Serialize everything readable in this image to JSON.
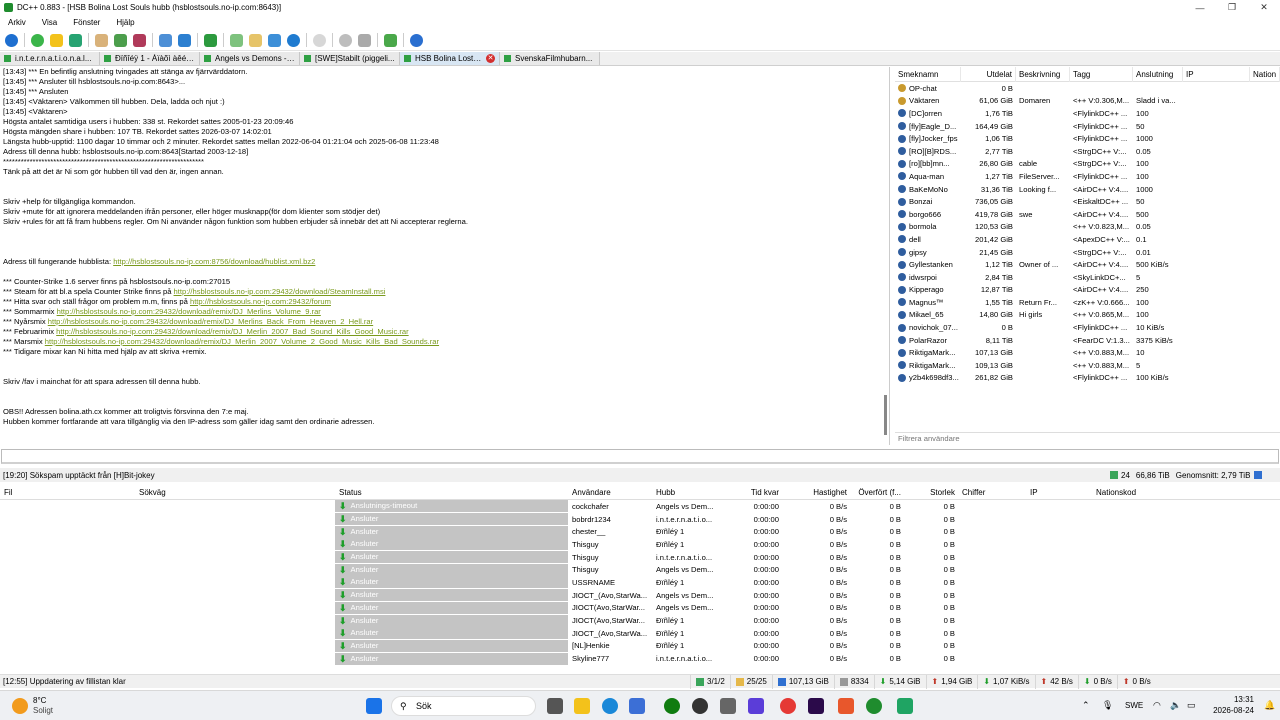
{
  "window": {
    "title": "DC++ 0.883 - [HSB Bolina Lost Souls hubb (hsblostsouls.no-ip.com:8643)]",
    "minimize": "—",
    "maximize": "❐",
    "close": "✕"
  },
  "menu": [
    "Arkiv",
    "Visa",
    "Fönster",
    "Hjälp"
  ],
  "tabs": [
    {
      "label": "i.n.t.e.r.n.a.t.i.o.n.a.l..."
    },
    {
      "label": "Ðïñîéÿ 1 - Àïàõì àêéå..."
    },
    {
      "label": "Angels vs Demons - ..."
    },
    {
      "label": "[SWE]Stabilt (piggeli..."
    },
    {
      "label": "HSB Bolina Lost ..."
    },
    {
      "label": "SvenskaFilmhubarn..."
    }
  ],
  "chat": [
    "[13:43] *** En befintlig anslutning tvingades att stänga av fjärrvärddatorn.",
    "[13:45] *** Ansluter till hsblostsouls.no-ip.com:8643>...",
    "[13:45] *** Ansluten",
    "[13:45] <Väktaren> Välkommen till hubben. Dela, ladda och njut :)",
    "[13:45] <Väktaren>",
    "Högsta antalet samtidiga users i hubben: 338 st. Rekordet sattes 2005-01-23 20:09:46",
    "Högsta mängden share i hubben: 107 TB. Rekordet sattes 2026-03-07 14:02:01",
    "Längsta hubb-upptid: 1100 dagar 10 timmar och 2 minuter. Rekordet sattes mellan 2022-06-04 01:21:04 och 2025-06-08 11:23:48",
    "Adress till denna hubb: hsblostsouls.no-ip.com:8643[Startad 2003-12-18]",
    "********************************************************************",
    "Tänk på att det är Ni som gör hubben till vad den är, ingen annan.",
    "",
    "",
    "Skriv +help för tillgängliga kommandon.",
    "Skriv +mute för att ignorera meddelanden ifrån personer, eller höger musknapp(för dom klienter som stödjer det)",
    "Skriv +rules för att få fram hubbens regler. Om Ni använder någon funktion som hubben erbjuder så innebär det att Ni accepterar reglerna.",
    "",
    "",
    "",
    "Adress till fungerande hubblista: |http://hsblostsouls.no-ip.com:8756/download/hublist.xml.bz2",
    "",
    "*** Counter-Strike 1.6 server finns på hsblostsouls.no-ip.com:27015",
    "*** Steam för att bl.a spela Counter Strike finns på |http://hsblostsouls.no-ip.com:29432/download/SteamInstall.msi",
    "*** Hitta svar och ställ frågor om problem m.m, finns på |http://hsblostsouls.no-ip.com:29432/forum",
    "*** Sommarmix |http://hsblostsouls.no-ip.com:29432/download/remix/DJ_Merlins_Volume_9.rar",
    "*** Nyårsmix |http://hsblostsouls.no-ip.com:29432/download/remix/DJ_Merlins_Back_From_Heaven_2_Hell.rar",
    "*** Februarimix |http://hsblostsouls.no-ip.com:29432/download/remix/DJ_Merlin_2007_Bad_Sound_Kills_Good_Music.rar",
    "*** Marsmix |http://hsblostsouls.no-ip.com:29432/download/remix/DJ_Merlin_2007_Volume_2_Good_Music_Kills_Bad_Sounds.rar",
    "*** Tidigare mixar kan Ni hitta med hjälp av att skriva +remix.",
    "",
    "",
    "Skriv /fav i mainchat för att spara adressen till denna hubb.",
    "",
    "",
    "OBS!! Adressen bolina.ath.cx kommer att troligtvis försvinna den 7:e maj.",
    "Hubben kommer fortfarande att vara tillgänglig via den IP-adress som gäller idag samt den ordinarie adressen."
  ],
  "userlist": {
    "columns": [
      "Smeknamn",
      "Utdelat",
      "Beskrivning",
      "Tagg",
      "Anslutning",
      "IP",
      "Nation"
    ],
    "rows": [
      [
        "OP-chat",
        "0 B",
        "",
        "",
        "",
        ""
      ],
      [
        "Väktaren",
        "61,06 GiB",
        "Domaren",
        "<++ V:0.306,M...",
        "Sladd i va...",
        ""
      ],
      [
        "[DC]orren",
        "1,76 TiB",
        "",
        "<FlylinkDC++ ...",
        "100",
        ""
      ],
      [
        "[fly]Eagle_D...",
        "164,49 GiB",
        "",
        "<FlylinkDC++ ...",
        "50",
        ""
      ],
      [
        "[fly]Jocker_fps",
        "1,06 TiB",
        "",
        "<FlylinkDC++ ...",
        "1000",
        ""
      ],
      [
        "[RO][B]RDS...",
        "2,77 TiB",
        "",
        "<StrgDC++ V:...",
        "0.05",
        ""
      ],
      [
        "[ro][bb]mn...",
        "26,80 GiB",
        "cable",
        "<StrgDC++ V:...",
        "100",
        ""
      ],
      [
        "Aqua-man",
        "1,27 TiB",
        "FileServer...",
        "<FlylinkDC++ ...",
        "100",
        ""
      ],
      [
        "BaKeMoNo",
        "31,36 TiB",
        "Looking f...",
        "<AirDC++ V:4....",
        "1000",
        ""
      ],
      [
        "Bonzai",
        "736,05 GiB",
        "",
        "<EiskaltDC++ ...",
        "50",
        ""
      ],
      [
        "borgo666",
        "419,78 GiB",
        "swe",
        "<AirDC++ V:4....",
        "500",
        ""
      ],
      [
        "bormola",
        "120,53 GiB",
        "",
        "<++ V:0.823,M...",
        "0.05",
        ""
      ],
      [
        "dell",
        "201,42 GiB",
        "",
        "<ApexDC++ V:...",
        "0.1",
        ""
      ],
      [
        "gipsy",
        "21,45 GiB",
        "",
        "<StrgDC++ V:...",
        "0.01",
        ""
      ],
      [
        "Gyllestanken",
        "1,12 TiB",
        "Owner of ...",
        "<AirDC++ V:4....",
        "500 KiB/s",
        ""
      ],
      [
        "idwsrpoi",
        "2,84 TiB",
        "",
        "<SkyLinkDC+...",
        "5",
        ""
      ],
      [
        "Kipperago",
        "12,87 TiB",
        "",
        "<AirDC++ V:4....",
        "250",
        ""
      ],
      [
        "Magnus™",
        "1,55 TiB",
        "Return Fr...",
        "<zK++ V:0.666...",
        "100",
        ""
      ],
      [
        "Mikael_65",
        "14,80 GiB",
        "Hi girls",
        "<++ V:0.865,M...",
        "100",
        ""
      ],
      [
        "novichok_07...",
        "0 B",
        "",
        "<FlylinkDC++ ...",
        "10 KiB/s",
        ""
      ],
      [
        "PolarRazor",
        "8,11 TiB",
        "",
        "<FearDC V:1.3...",
        "3375 KiB/s",
        ""
      ],
      [
        "RiktigaMark...",
        "107,13 GiB",
        "",
        "<++ V:0.883,M...",
        "10",
        ""
      ],
      [
        "RiktigaMark...",
        "109,13 GiB",
        "",
        "<++ V:0.883,M...",
        "5",
        ""
      ],
      [
        "y2b4k698df3...",
        "261,82 GiB",
        "",
        "<FlylinkDC++ ...",
        "100 KiB/s",
        ""
      ]
    ],
    "filter_placeholder": "Filtrera användare"
  },
  "status_line": {
    "message": "[19:20] Sökspam upptäckt från [H]Bit-jokey",
    "users": "24",
    "share": "66,86 TiB",
    "avg": "Genomsnitt: 2,79 TiB"
  },
  "transfers": {
    "columns": [
      "Fil",
      "Sökväg",
      "Status",
      "Användare",
      "Hubb",
      "Tid kvar",
      "Hastighet",
      "Överfört (f...",
      "Storlek",
      "Chiffer",
      "IP",
      "Nationskod"
    ],
    "rows": [
      [
        "Anslutnings-timeout",
        "cockchafer",
        "Angels vs Dem..."
      ],
      [
        "Ansluter",
        "bobrdr1234",
        "i.n.t.e.r.n.a.t.i.o..."
      ],
      [
        "Ansluter",
        "chester__",
        "Ðïñîéÿ 1"
      ],
      [
        "Ansluter",
        "Thisguy",
        "Ðïñîéÿ 1"
      ],
      [
        "Ansluter",
        "Thisguy",
        "i.n.t.e.r.n.a.t.i.o..."
      ],
      [
        "Ansluter",
        "Thisguy",
        "Angels vs Dem..."
      ],
      [
        "Ansluter",
        "USSRNAME",
        "Ðïñîéÿ 1"
      ],
      [
        "Ansluter",
        "JIOCT_(Avo,StarWa...",
        "Angels vs Dem..."
      ],
      [
        "Ansluter",
        "JIOCT(Avo,StarWar...",
        "Angels vs Dem..."
      ],
      [
        "Ansluter",
        "JIOCT(Avo,StarWar...",
        "Ðïñîéÿ 1"
      ],
      [
        "Ansluter",
        "JIOCT_(Avo,StarWa...",
        "Ðïñîéÿ 1"
      ],
      [
        "Ansluter",
        "[NL]Henkie",
        "Ðïñîéÿ 1"
      ],
      [
        "Ansluter",
        "Skyline777",
        "i.n.t.e.r.n.a.t.i.o..."
      ]
    ],
    "time": "0:00:00",
    "speed": "0 B/s",
    "transferred": "0 B",
    "size": "0 B"
  },
  "bottom_status": {
    "message": "[12:55] Uppdatering av fillistan klar",
    "hubs": "3/1/2",
    "slots": "25/25",
    "upshare": "107,13 GiB",
    "count": "8334",
    "down_total": "5,14 GiB",
    "up_total": "1,94 GiB",
    "down_speed": "1,07 KiB/s",
    "up_speed": "42 B/s",
    "down2": "0 B/s",
    "up2": "0 B/s"
  },
  "taskbar": {
    "temp": "8°C",
    "weather": "Soligt",
    "search": "Sök",
    "lang": "SWE",
    "time": "13:31",
    "date": "2026-08-24"
  }
}
